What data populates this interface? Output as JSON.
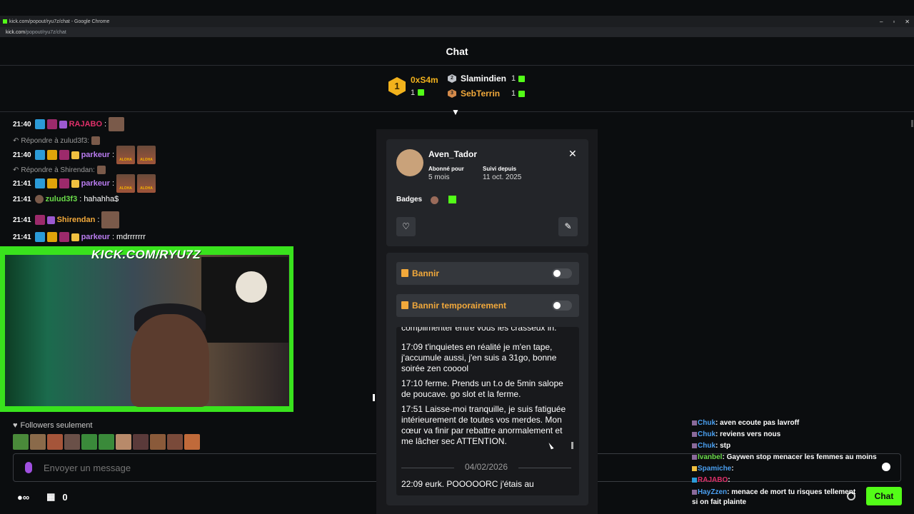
{
  "browser": {
    "window_title": "kick.com/popout/ryu7z/chat - Google Chrome",
    "url_host": "kick.com",
    "url_path": "/popout/ryu7z/chat",
    "controls": [
      "–",
      "▫",
      "✕"
    ]
  },
  "page": {
    "title": "Chat"
  },
  "leaderboard": {
    "first": {
      "rank": "1",
      "name": "0xS4m",
      "count": "1"
    },
    "second": {
      "rank": "2",
      "name": "Slamindien",
      "count": "1"
    },
    "third": {
      "rank": "3",
      "name": "SebTerrin",
      "count": "1"
    }
  },
  "chat": {
    "messages": [
      {
        "time": "21:40",
        "user": "RAJABO",
        "user_color": "#e0306a",
        "text": ":"
      },
      {
        "reply_to": "Répondre à zulud3f3:",
        "time": "21:40",
        "user": "parkeur",
        "user_color": "#b97cf0",
        "text": ":"
      },
      {
        "reply_to": "Répondre à Shirendan:",
        "time": "21:41",
        "user": "parkeur",
        "user_color": "#b97cf0",
        "text": ":"
      },
      {
        "time": "21:41",
        "user": "zulud3f3",
        "user_color": "#6bdd4a",
        "text": ": hahahha$"
      },
      {
        "time": "21:41",
        "user": "Shirendan",
        "user_color": "#f2a93b",
        "text": ":"
      },
      {
        "time": "21:41",
        "user": "parkeur",
        "user_color": "#b97cf0",
        "text": ": mdrrrrrrr"
      }
    ],
    "emote_label": "ALOHA",
    "followers_only": "Followers seulement",
    "input_placeholder": "Envoyer un message",
    "points": "0",
    "send_label": "Chat"
  },
  "webcam": {
    "overlay_text": "KICK.COM/RYU7Z"
  },
  "user_card": {
    "username": "Aven_Tador",
    "subscribed_label": "Abonné pour",
    "subscribed_value": "5 mois",
    "following_label": "Suivi depuis",
    "following_value": "11 oct. 2025",
    "badges_label": "Badges"
  },
  "moderation": {
    "ban_label": "Bannir",
    "timeout_label": "Bannir temporairement",
    "history": [
      {
        "text": "complimenter entre vous les crasseux in."
      },
      {
        "text": "17:09 t'inquietes en réalité je m'en tape, j'accumule aussi, j'en suis a 31go, bonne soirée zen cooool"
      },
      {
        "text": "17:10 ferme. Prends un t.o de 5min salope de poucave. go slot et la ferme."
      },
      {
        "text": "17:51 Laisse-moi tranquille, je suis fatiguée intérieurement de toutes vos merdes. Mon cœur va finir par rebattre anormalement et me lâcher sec ATTENTION."
      },
      {
        "text": "22:09 eurk. POOOOORC j'étais au"
      }
    ],
    "date_separator": "04/02/2026"
  },
  "right_chat": [
    {
      "user": "Chuk",
      "user_color": "#4a9ff0",
      "text": ": aven ecoute pas lavroff"
    },
    {
      "user": "Chuk",
      "user_color": "#4a9ff0",
      "text": ": reviens vers nous"
    },
    {
      "user": "Chuk",
      "user_color": "#4a9ff0",
      "text": ": stp"
    },
    {
      "user": "Ivanbel",
      "user_color": "#6bdd4a",
      "text": ": Gaywen stop menacer les femmes au moins"
    },
    {
      "user": "Spamiche",
      "user_color": "#4a9ff0",
      "text": ":"
    },
    {
      "user": "RAJABO",
      "user_color": "#e0306a",
      "text": ":"
    },
    {
      "user": "HayZzen",
      "user_color": "#4a9ff0",
      "text": ": menace de mort tu risques tellement si on fait plainte"
    }
  ],
  "colors": {
    "accent": "#53fc18",
    "mod_orange": "#f2a93b"
  }
}
